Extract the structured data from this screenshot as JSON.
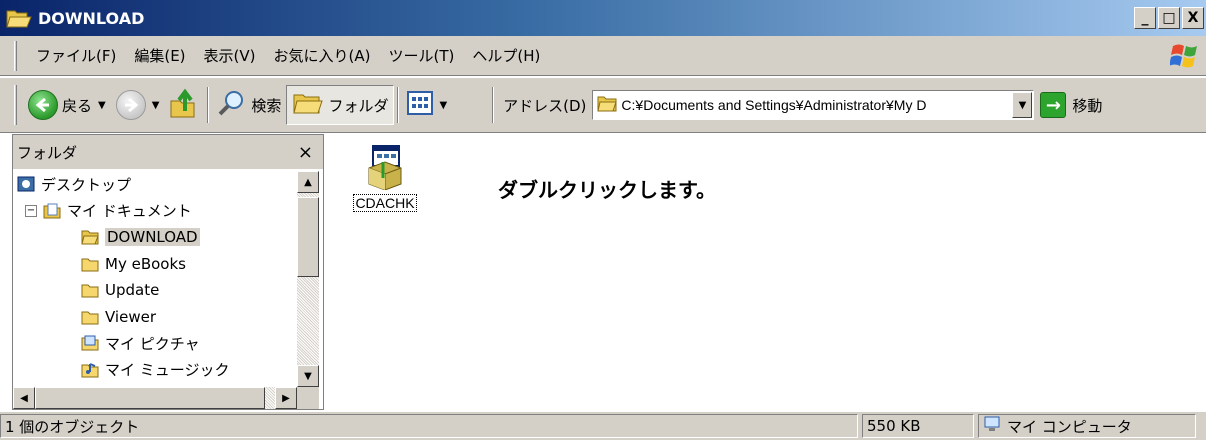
{
  "window": {
    "title": "DOWNLOAD",
    "minimize": "_",
    "maximize": "□",
    "close": "X"
  },
  "menubar": {
    "items": [
      "ファイル(F)",
      "編集(E)",
      "表示(V)",
      "お気に入り(A)",
      "ツール(T)",
      "ヘルプ(H)"
    ]
  },
  "toolbar": {
    "back_label": "戻る",
    "search_label": "検索",
    "folders_label": "フォルダ",
    "address_label": "アドレス(D)",
    "address_value": "C:¥Documents and Settings¥Administrator¥My D",
    "go_label": "移動"
  },
  "folder_pane": {
    "title": "フォルダ",
    "close": "×",
    "tree": [
      {
        "label": "デスクトップ",
        "icon": "desktop-icon"
      },
      {
        "label": "マイ ドキュメント",
        "icon": "documents-icon",
        "expander": "−"
      },
      {
        "label": "DOWNLOAD",
        "icon": "folder-open-icon",
        "selected": true
      },
      {
        "label": "My eBooks",
        "icon": "folder-icon"
      },
      {
        "label": "Update",
        "icon": "folder-icon"
      },
      {
        "label": "Viewer",
        "icon": "folder-icon"
      },
      {
        "label": "マイ ピクチャ",
        "icon": "pictures-icon"
      },
      {
        "label": "マイ ミュージック",
        "icon": "music-icon"
      }
    ]
  },
  "content": {
    "file_name": "CDACHK",
    "annotation": "ダブルクリックします。"
  },
  "statusbar": {
    "objects": "1 個のオブジェクト",
    "size": "550 KB",
    "zone": "マイ コンピュータ"
  },
  "colors": {
    "title_gradient_start": "#0a246a",
    "title_gradient_end": "#a6caf0",
    "chrome": "#d4d0c8",
    "folder_yellow": "#f5d76e"
  }
}
